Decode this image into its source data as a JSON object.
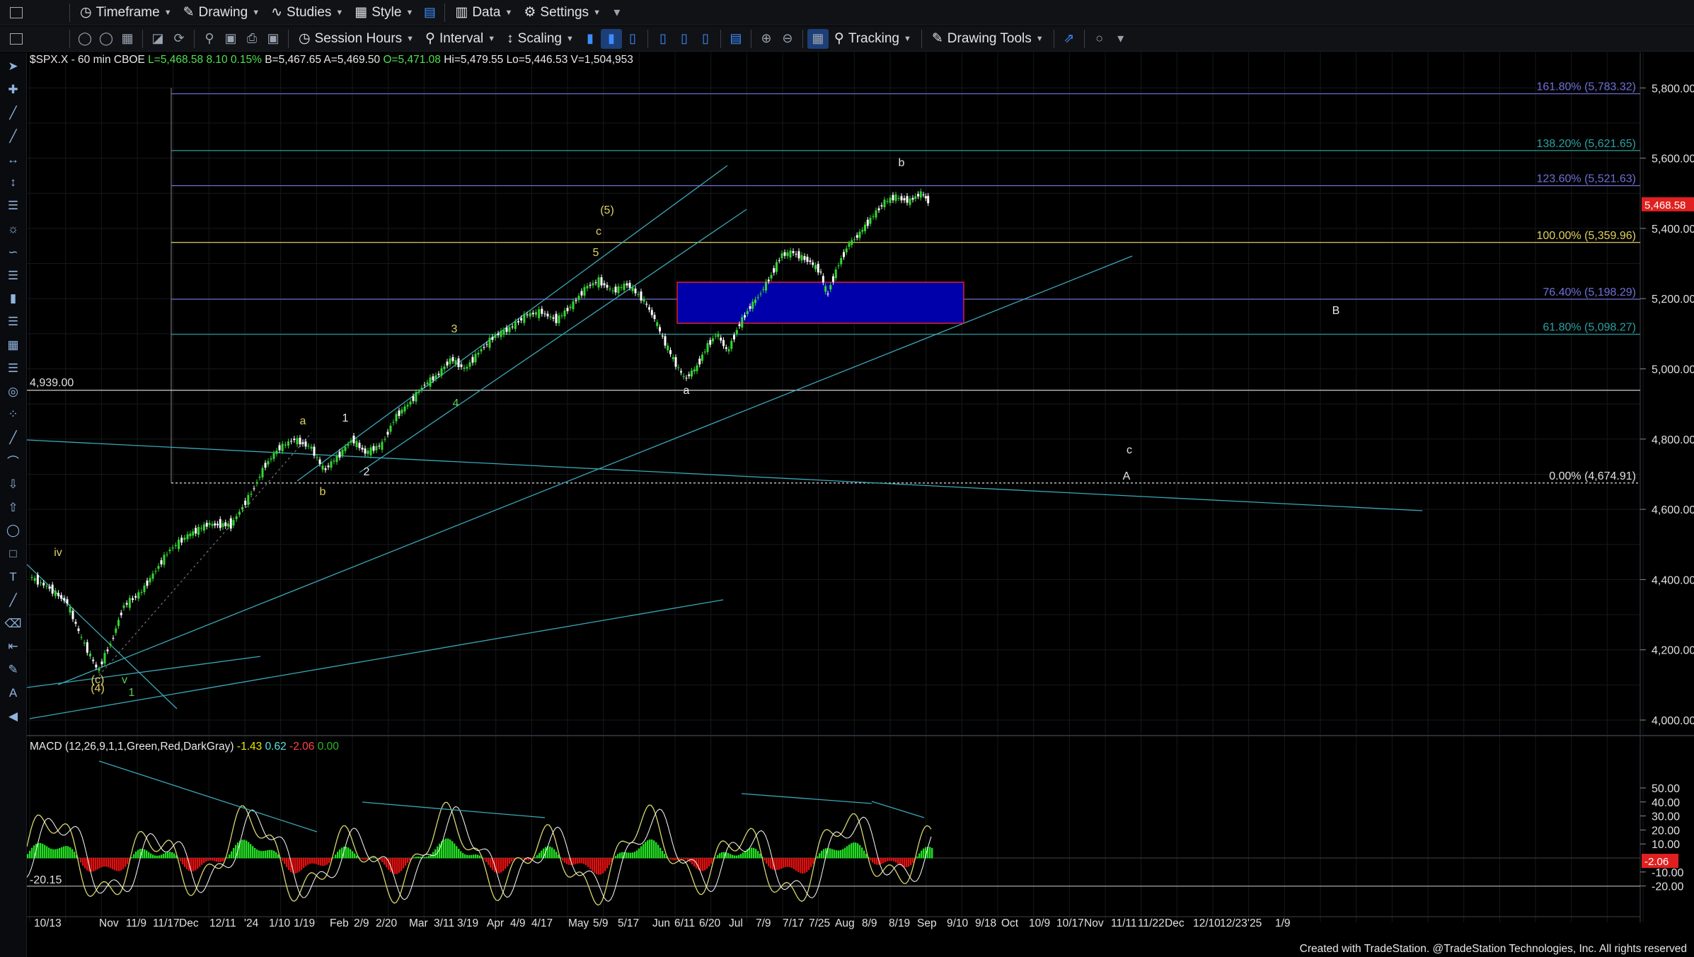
{
  "toolbar1": {
    "timeframe": "Timeframe",
    "drawing": "Drawing",
    "studies": "Studies",
    "style": "Style",
    "data": "Data",
    "settings": "Settings"
  },
  "toolbar2": {
    "session_hours": "Session Hours",
    "interval": "Interval",
    "scaling": "Scaling",
    "tracking": "Tracking",
    "drawing_tools": "Drawing Tools"
  },
  "symbol_bar": {
    "symbol": "$SPX.X - 60 min",
    "exchange": "CBOE",
    "last": "L=5,468.58",
    "change": "8.10",
    "change_pct": "0.15%",
    "bid": "B=5,467.65",
    "ask": "A=5,469.50",
    "open": "O=5,471.08",
    "high": "Hi=5,479.55",
    "low": "Lo=5,446.53",
    "volume": "V=1,504,953"
  },
  "price_axis": {
    "ticks": [
      "5,800.00",
      "5,600.00",
      "5,400.00",
      "5,200.00",
      "5,000.00",
      "4,800.00",
      "4,600.00",
      "4,400.00",
      "4,200.00",
      "4,000.00"
    ],
    "last_price_tag": "5,468.58",
    "horizontal_line_label": "4,939.00"
  },
  "fib_levels": [
    {
      "label": "161.80% (5,783.32)",
      "color": "#6f6fd8"
    },
    {
      "label": "138.20% (5,621.65)",
      "color": "#2aa0a0"
    },
    {
      "label": "123.60% (5,521.63)",
      "color": "#6f6fd8"
    },
    {
      "label": "100.00% (5,359.96)",
      "color": "#e0d060"
    },
    {
      "label": "76.40% (5,198.29)",
      "color": "#6f6fd8"
    },
    {
      "label": "61.80% (5,098.27)",
      "color": "#2aa0a0"
    },
    {
      "label": "0.00% (4,674.91)",
      "color": "#e0e0e0"
    }
  ],
  "wave_labels": {
    "yellow": [
      "(5)",
      "c",
      "5",
      "3",
      "a",
      "b",
      "(c)",
      "(4)",
      "iv"
    ],
    "white": [
      "b",
      "a",
      "1",
      "2",
      "B",
      "c",
      "A",
      "v",
      "1",
      "4"
    ]
  },
  "macd": {
    "title": "MACD (12,26,9,1,1,Green,Red,DarkGray)",
    "v1": "-1.43",
    "v2": "0.62",
    "v3": "-2.06",
    "v4": "0.00",
    "ticks": [
      "50.00",
      "40.00",
      "30.00",
      "20.00",
      "10.00",
      "-10.00",
      "-20.00"
    ],
    "last_tag": "-2.06",
    "left_label": "-20.15"
  },
  "time_axis": [
    "10/13",
    "Nov",
    "11/9",
    "11/17",
    "Dec",
    "12/11",
    "'24",
    "1/10",
    "1/19",
    "Feb",
    "2/9",
    "2/20",
    "Mar",
    "3/11",
    "3/19",
    "Apr",
    "4/9",
    "4/17",
    "May",
    "5/9",
    "5/17",
    "Jun",
    "6/11",
    "6/20",
    "Jul",
    "7/9",
    "7/17",
    "7/25",
    "Aug",
    "8/9",
    "8/19",
    "Sep",
    "9/10",
    "9/18",
    "Oct",
    "10/9",
    "10/17",
    "Nov",
    "11/11",
    "11/22",
    "Dec",
    "12/10",
    "12/23",
    "'25",
    "1/9"
  ],
  "footer": "Created with TradeStation. @TradeStation Technologies, Inc. All rights reserved",
  "colors": {
    "background": "#000000",
    "up_candle": "#33d633",
    "down_candle": "#ffffff",
    "macd_pos": "#22dd22",
    "macd_neg": "#e01010",
    "macd_line": "#d8d870",
    "macd_signal": "#ffffff",
    "trendline": "#3aa8b8",
    "box_fill": "#0000aa",
    "box_border": "#e02020"
  }
}
